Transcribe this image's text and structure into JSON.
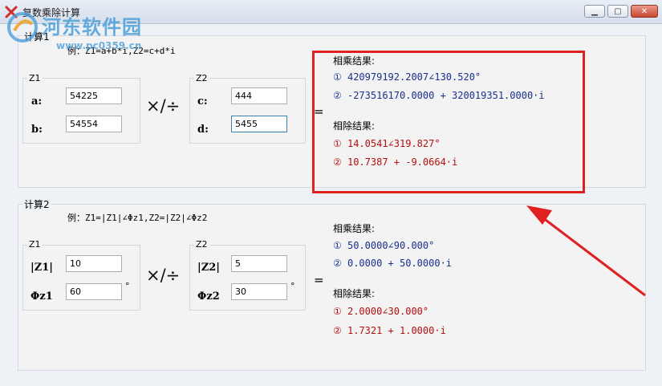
{
  "window": {
    "title": "复数乘除计算"
  },
  "watermark": {
    "brand": "河东软件园",
    "url": "www.pc0359.cn"
  },
  "calc1": {
    "caption": "计算1",
    "example": "例：Z1=a+b*i,Z2=c+d*i",
    "z1": {
      "caption": "Z1",
      "a_label": "a:",
      "a_value": "54225",
      "b_label": "b:",
      "b_value": "54554"
    },
    "z2": {
      "caption": "Z2",
      "c_label": "c:",
      "c_value": "444",
      "d_label": "d:",
      "d_value": "5455"
    },
    "operator": "×/÷",
    "equals": "=",
    "mul_title": "相乘结果:",
    "mul_polar": "① 420979192.2007∠130.520°",
    "mul_rect": "② -273516170.0000 + 320019351.0000·i",
    "div_title": "相除结果:",
    "div_polar": "① 14.0541∠319.827°",
    "div_rect": "② 10.7387 + -9.0664·i"
  },
  "calc2": {
    "caption": "计算2",
    "example": "例：Z1=|Z1|∠Φz1,Z2=|Z2|∠Φz2",
    "z1": {
      "caption": "Z1",
      "mag_label": "|Z1|",
      "mag_value": "10",
      "phase_label": "Φz1",
      "phase_value": "60",
      "deg": "°"
    },
    "z2": {
      "caption": "Z2",
      "mag_label": "|Z2|",
      "mag_value": "5",
      "phase_label": "Φz2",
      "phase_value": "30",
      "deg": "°"
    },
    "operator": "×/÷",
    "equals": "=",
    "mul_title": "相乘结果:",
    "mul_polar": "① 50.0000∠90.000°",
    "mul_rect": "② 0.0000 + 50.0000·i",
    "div_title": "相除结果:",
    "div_polar": "① 2.0000∠30.000°",
    "div_rect": "② 1.7321 + 1.0000·i"
  },
  "colors": {
    "result_blue": "#1a2f8c",
    "result_red": "#b30f0f",
    "annotation_red": "#e02121"
  }
}
